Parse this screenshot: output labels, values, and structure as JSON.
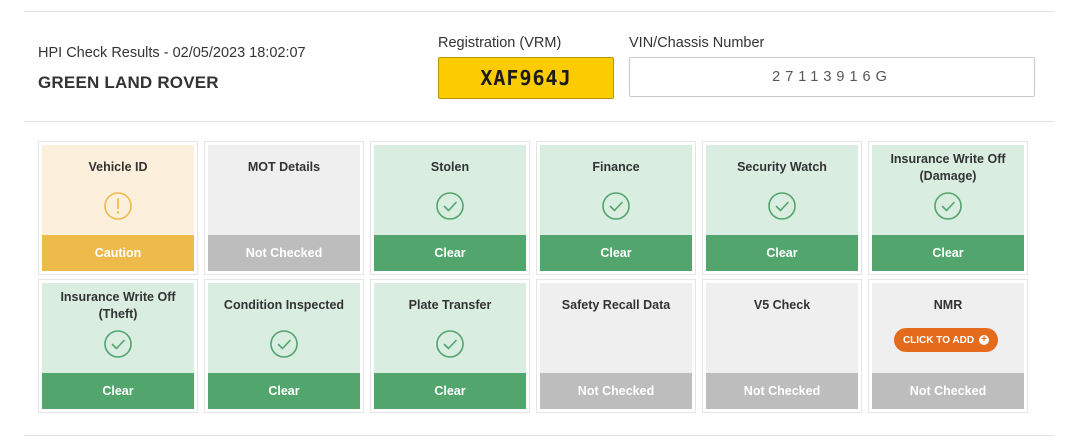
{
  "header": {
    "results_line": "HPI Check Results - 02/05/2023 18:02:07",
    "vehicle": "GREEN LAND ROVER",
    "registration_label": "Registration (VRM)",
    "registration": "XAF964J",
    "vin_label": "VIN/Chassis Number",
    "vin": "27113916G"
  },
  "tiles": [
    {
      "title": "Vehicle ID",
      "status": "Caution",
      "state": "caution",
      "icon": "caution-icon"
    },
    {
      "title": "MOT Details",
      "status": "Not Checked",
      "state": "not-checked",
      "icon": "none"
    },
    {
      "title": "Stolen",
      "status": "Clear",
      "state": "clear",
      "icon": "check-icon"
    },
    {
      "title": "Finance",
      "status": "Clear",
      "state": "clear",
      "icon": "check-icon"
    },
    {
      "title": "Security Watch",
      "status": "Clear",
      "state": "clear",
      "icon": "check-icon"
    },
    {
      "title": "Insurance Write Off (Damage)",
      "status": "Clear",
      "state": "clear",
      "icon": "check-icon"
    },
    {
      "title": "Insurance Write Off (Theft)",
      "status": "Clear",
      "state": "clear",
      "icon": "check-icon"
    },
    {
      "title": "Condition Inspected",
      "status": "Clear",
      "state": "clear",
      "icon": "check-icon"
    },
    {
      "title": "Plate Transfer",
      "status": "Clear",
      "state": "clear",
      "icon": "check-icon"
    },
    {
      "title": "Safety Recall Data",
      "status": "Not Checked",
      "state": "not-checked",
      "icon": "none"
    },
    {
      "title": "V5 Check",
      "status": "Not Checked",
      "state": "not-checked",
      "icon": "none"
    },
    {
      "title": "NMR",
      "status": "Not Checked",
      "state": "not-checked",
      "icon": "plus-circle-icon",
      "button": "CLICK TO ADD"
    }
  ],
  "colors": {
    "clear_bg": "#d9ede0",
    "clear_bar": "#52a56c",
    "caution_bg": "#fcefdb",
    "caution_bar": "#eebb4b",
    "nc_bg": "#efefef",
    "nc_bar": "#bdbdbd",
    "plate_yellow": "#fdcc00",
    "action_orange": "#e46a1c"
  }
}
